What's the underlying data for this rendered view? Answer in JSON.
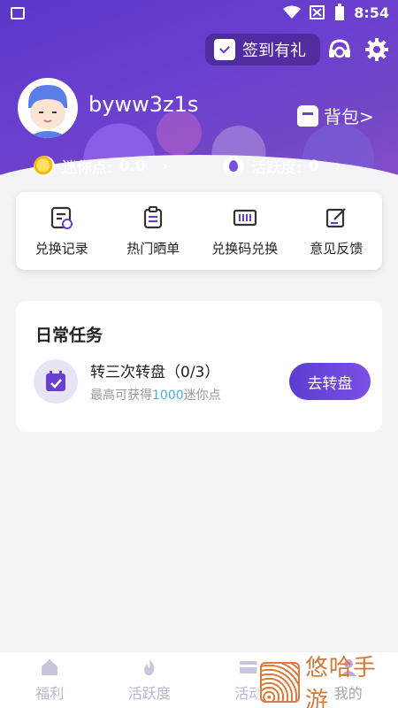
{
  "status_bar": {
    "time": "8:54"
  },
  "header": {
    "sign_in_label": "签到有礼",
    "username": "byww3z1s",
    "backpack_label": "背包>",
    "mini_points_label": "迷你点:",
    "mini_points_value": "0.0",
    "activity_label": "活跃度:",
    "activity_value": "0"
  },
  "quick_actions": [
    {
      "label": "兑换记录",
      "icon": "exchange-record-icon"
    },
    {
      "label": "热门晒单",
      "icon": "hot-share-icon"
    },
    {
      "label": "兑换码兑换",
      "icon": "redeem-code-icon"
    },
    {
      "label": "意见反馈",
      "icon": "feedback-icon"
    }
  ],
  "daily_tasks": {
    "title": "日常任务",
    "tasks": [
      {
        "name": "转三次转盘（0/3）",
        "sub_prefix": "最高可获得",
        "sub_amount": "1000",
        "sub_suffix": "迷你点",
        "button": "去转盘"
      }
    ]
  },
  "bottom_nav": [
    {
      "label": "福利",
      "icon": "home-icon"
    },
    {
      "label": "活跃度",
      "icon": "fire-icon"
    },
    {
      "label": "活动",
      "icon": "card-icon"
    },
    {
      "label": "我的",
      "icon": "profile-icon"
    }
  ],
  "watermark": {
    "text": "悠哈手游"
  },
  "colors": {
    "accent": "#6a3fd0",
    "highlight": "#3fb6e0"
  }
}
